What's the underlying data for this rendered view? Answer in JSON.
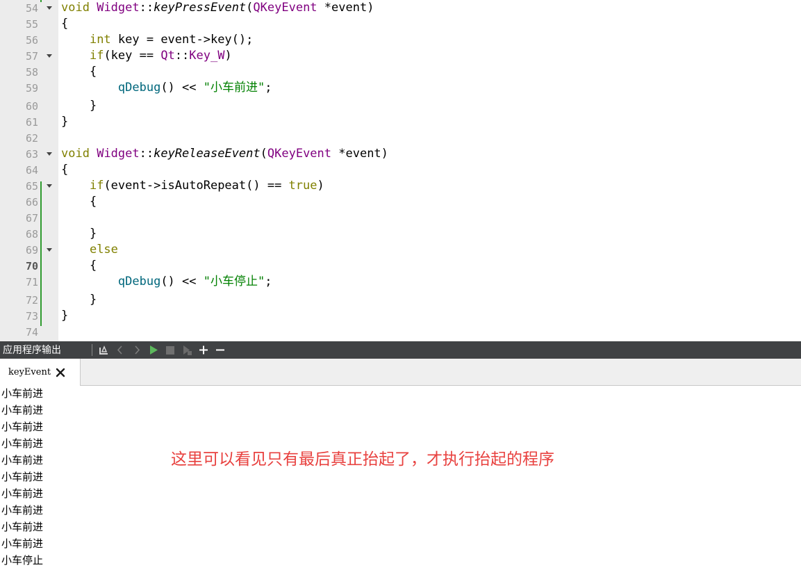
{
  "editor": {
    "lines": [
      {
        "num": "54",
        "fold": true,
        "tokens": [
          {
            "t": "void",
            "c": "kw"
          },
          {
            "t": " "
          },
          {
            "t": "Widget",
            "c": "ty"
          },
          {
            "t": "::"
          },
          {
            "t": "keyPressEvent",
            "c": "it"
          },
          {
            "t": "("
          },
          {
            "t": "QKeyEvent",
            "c": "ty"
          },
          {
            "t": " *event)"
          }
        ]
      },
      {
        "num": "55",
        "tokens": [
          {
            "t": "{"
          }
        ]
      },
      {
        "num": "56",
        "tokens": [
          {
            "t": "    "
          },
          {
            "t": "int",
            "c": "kw"
          },
          {
            "t": " key = event->key();"
          }
        ]
      },
      {
        "num": "57",
        "fold": true,
        "tokens": [
          {
            "t": "    "
          },
          {
            "t": "if",
            "c": "kw"
          },
          {
            "t": "(key == "
          },
          {
            "t": "Qt",
            "c": "ty"
          },
          {
            "t": "::"
          },
          {
            "t": "Key_W",
            "c": "ty"
          },
          {
            "t": ")"
          }
        ]
      },
      {
        "num": "58",
        "tokens": [
          {
            "t": "    {"
          }
        ]
      },
      {
        "num": "59",
        "tokens": [
          {
            "t": "        "
          },
          {
            "t": "qDebug",
            "c": "fn"
          },
          {
            "t": "() << "
          },
          {
            "t": "\"小车前进\"",
            "c": "str"
          },
          {
            "t": ";"
          }
        ]
      },
      {
        "num": "60",
        "tokens": [
          {
            "t": "    }"
          }
        ]
      },
      {
        "num": "61",
        "tokens": [
          {
            "t": "}"
          }
        ]
      },
      {
        "num": "62",
        "tokens": []
      },
      {
        "num": "63",
        "fold": true,
        "tokens": [
          {
            "t": "void",
            "c": "kw"
          },
          {
            "t": " "
          },
          {
            "t": "Widget",
            "c": "ty"
          },
          {
            "t": "::"
          },
          {
            "t": "keyReleaseEvent",
            "c": "it"
          },
          {
            "t": "("
          },
          {
            "t": "QKeyEvent",
            "c": "ty"
          },
          {
            "t": " *event)"
          }
        ]
      },
      {
        "num": "64",
        "tokens": [
          {
            "t": "{"
          }
        ]
      },
      {
        "num": "65",
        "fold": true,
        "tokens": [
          {
            "t": "    "
          },
          {
            "t": "if",
            "c": "kw"
          },
          {
            "t": "(event->isAutoRepeat() == "
          },
          {
            "t": "true",
            "c": "kw"
          },
          {
            "t": ")"
          }
        ]
      },
      {
        "num": "66",
        "tokens": [
          {
            "t": "    {"
          }
        ]
      },
      {
        "num": "67",
        "tokens": []
      },
      {
        "num": "68",
        "tokens": [
          {
            "t": "    }"
          }
        ]
      },
      {
        "num": "69",
        "fold": true,
        "tokens": [
          {
            "t": "    "
          },
          {
            "t": "else",
            "c": "kw"
          }
        ]
      },
      {
        "num": "70",
        "current": true,
        "tokens": [
          {
            "t": "    {"
          }
        ]
      },
      {
        "num": "71",
        "tokens": [
          {
            "t": "        "
          },
          {
            "t": "qDebug",
            "c": "fn"
          },
          {
            "t": "() << "
          },
          {
            "t": "\"小车停止\"",
            "c": "str"
          },
          {
            "t": ";"
          }
        ]
      },
      {
        "num": "72",
        "tokens": [
          {
            "t": "    }"
          }
        ]
      },
      {
        "num": "73",
        "tokens": [
          {
            "t": "}"
          }
        ]
      },
      {
        "num": "74",
        "tokens": []
      }
    ]
  },
  "output_pane": {
    "title": "应用程序输出",
    "toolbar_icons": [
      "attach-debugger-icon",
      "previous-icon",
      "next-icon",
      "run-icon",
      "stop-icon",
      "debug-run-icon",
      "zoom-in-icon",
      "zoom-out-icon"
    ],
    "tab_label": "keyEvent",
    "tab_close_icon": "close-icon",
    "lines": [
      "小车前进",
      "小车前进",
      "小车前进",
      "小车前进",
      "小车前进",
      "小车前进",
      "小车前进",
      "小车前进",
      "小车前进",
      "小车前进",
      "小车停止"
    ]
  },
  "annotation": "这里可以看见只有最后真正抬起了，才执行抬起的程序",
  "colors": {
    "keyword": "#808000",
    "type": "#800080",
    "function": "#00677c",
    "string": "#008000",
    "annotation": "#e8413f",
    "toolbar_bg": "#404244",
    "run_icon": "#5cb85c",
    "change_bar": "#2f9b2f"
  }
}
